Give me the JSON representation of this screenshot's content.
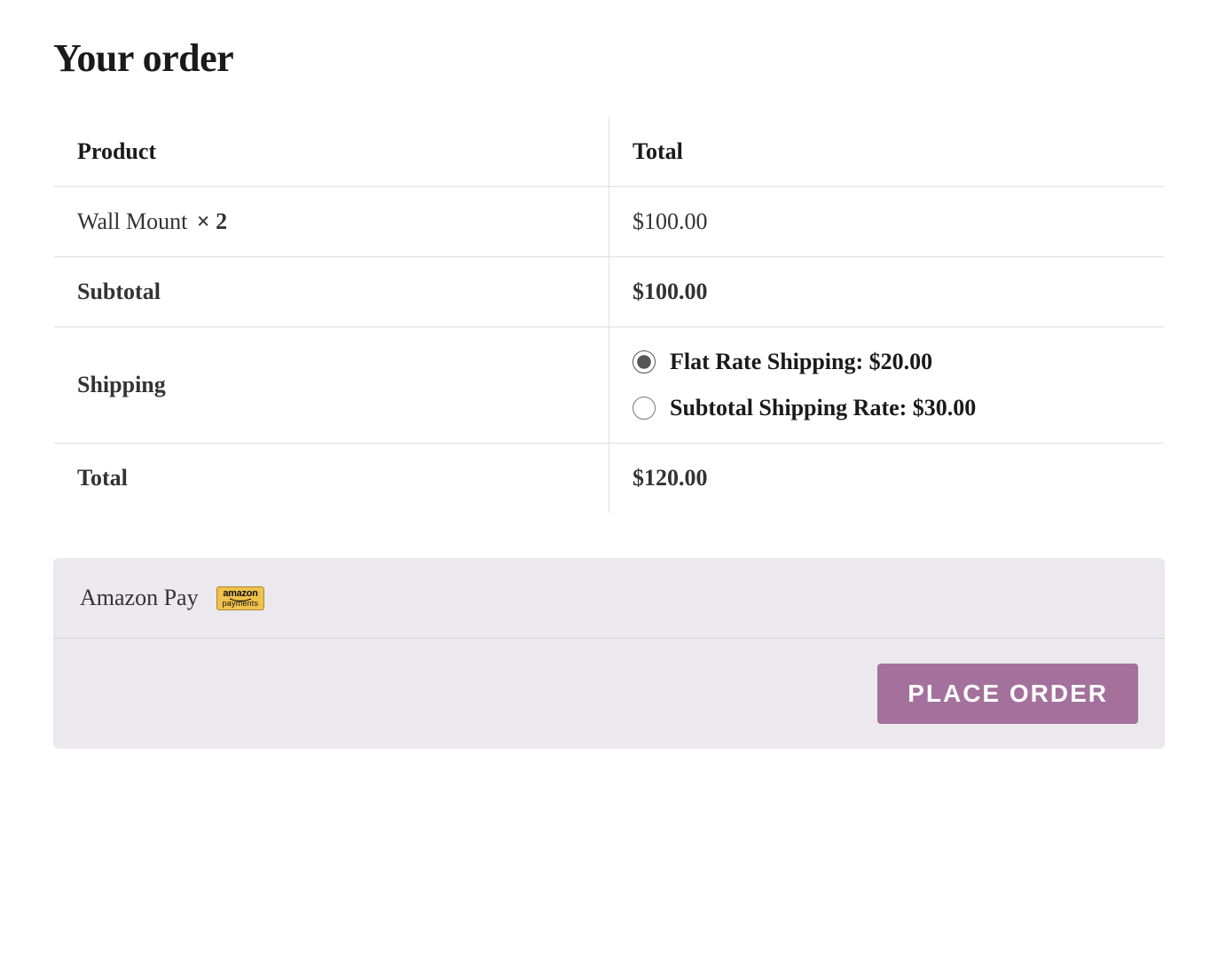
{
  "heading": "Your order",
  "columns": {
    "product": "Product",
    "total": "Total"
  },
  "item": {
    "name": "Wall Mount ",
    "qty_label": "× 2",
    "total": "$100.00"
  },
  "subtotal": {
    "label": "Subtotal",
    "value": "$100.00"
  },
  "shipping": {
    "label": "Shipping",
    "options": [
      {
        "label": "Flat Rate Shipping: $20.00",
        "selected": true
      },
      {
        "label": "Subtotal Shipping Rate: $30.00",
        "selected": false
      }
    ]
  },
  "total": {
    "label": "Total",
    "value": "$120.00"
  },
  "payment": {
    "method_label": "Amazon Pay",
    "badge_top": "amazon",
    "badge_bottom": "payments"
  },
  "place_order_label": "PLACE ORDER"
}
